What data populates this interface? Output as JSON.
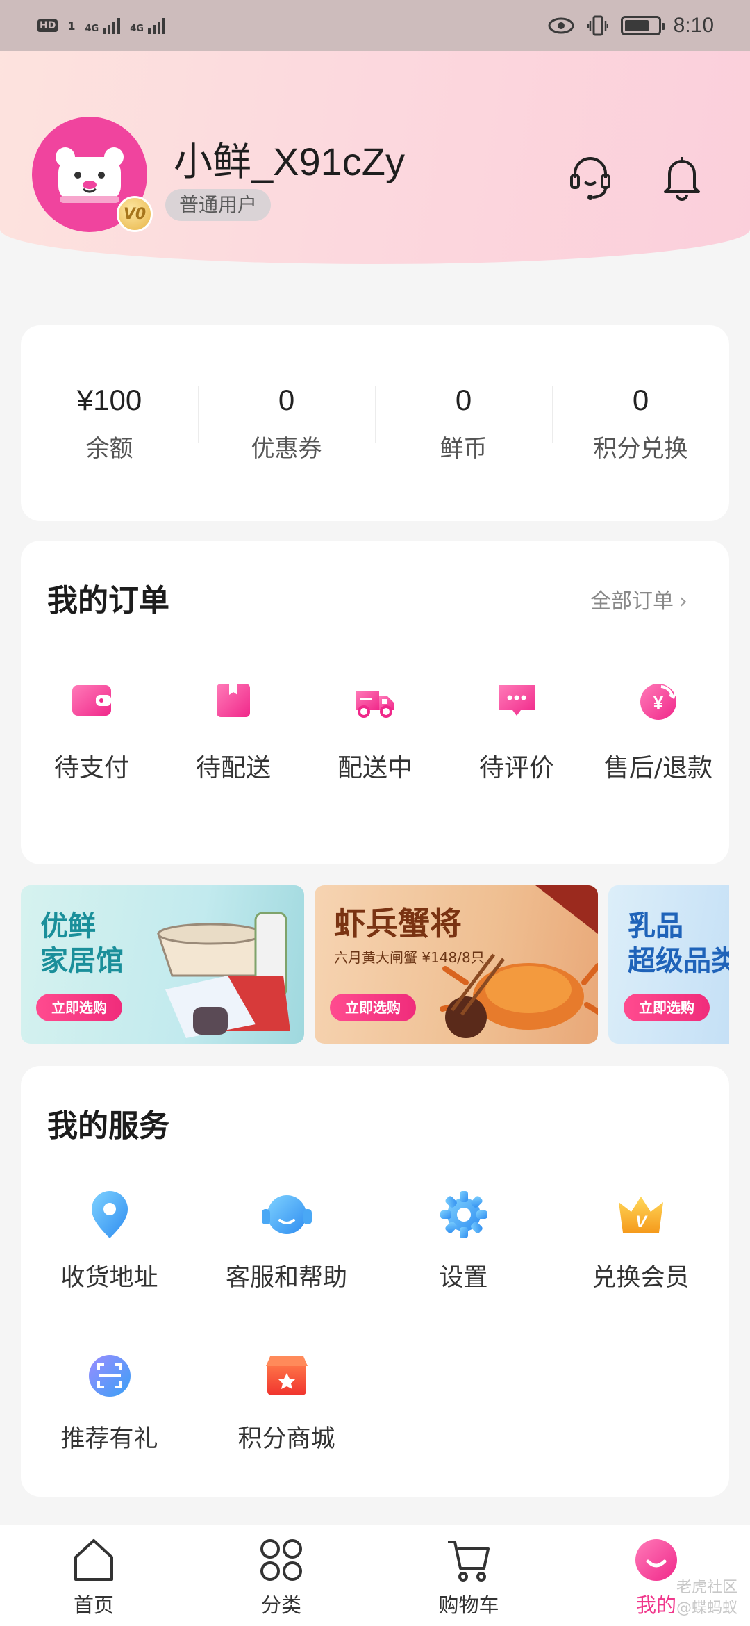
{
  "status_bar": {
    "hd": "HD",
    "sim1": "1",
    "net1": "4G",
    "net2": "4G",
    "time": "8:10",
    "battery_level": 0.75,
    "icons": [
      "eye-icon",
      "vibrate-icon",
      "battery-icon"
    ]
  },
  "profile": {
    "username": "小鲜_X91cZy",
    "level": "普通用户",
    "vip_badge": "V0",
    "avatar_icon": "bear-avatar-icon",
    "header_icons": [
      "headset-icon",
      "bell-icon"
    ]
  },
  "wallet": [
    {
      "value": "¥100",
      "label": "余额"
    },
    {
      "value": "0",
      "label": "优惠券"
    },
    {
      "value": "0",
      "label": "鲜币"
    },
    {
      "value": "0",
      "label": "积分兑换"
    }
  ],
  "orders": {
    "title": "我的订单",
    "all_label": "全部订单",
    "chevron": "›",
    "items": [
      {
        "label": "待支付",
        "icon": "wallet-icon"
      },
      {
        "label": "待配送",
        "icon": "package-icon"
      },
      {
        "label": "配送中",
        "icon": "delivery-truck-icon"
      },
      {
        "label": "待评价",
        "icon": "comment-icon"
      },
      {
        "label": "售后/退款",
        "icon": "refund-icon"
      }
    ]
  },
  "banners": [
    {
      "title_line1": "优鲜",
      "title_line2": "家居馆",
      "subtitle": "",
      "button": "立即选购"
    },
    {
      "title_line1": "虾兵蟹将",
      "title_line2": "",
      "subtitle": "六月黄大闸蟹 ¥148/8只",
      "button": "立即选购"
    },
    {
      "title_line1": "乳品",
      "title_line2": "超级品类",
      "subtitle": "",
      "button": "立即选购"
    }
  ],
  "services": {
    "title": "我的服务",
    "items": [
      {
        "label": "收货地址",
        "icon": "location-pin-icon"
      },
      {
        "label": "客服和帮助",
        "icon": "customer-service-icon"
      },
      {
        "label": "设置",
        "icon": "settings-gear-icon"
      },
      {
        "label": "兑换会员",
        "icon": "crown-icon"
      },
      {
        "label": "推荐有礼",
        "icon": "scan-icon"
      },
      {
        "label": "积分商城",
        "icon": "store-icon"
      }
    ]
  },
  "tabbar": {
    "items": [
      {
        "label": "首页",
        "icon": "home-icon"
      },
      {
        "label": "分类",
        "icon": "grid-icon"
      },
      {
        "label": "购物车",
        "icon": "cart-icon"
      },
      {
        "label": "我的",
        "icon": "profile-smile-icon"
      }
    ],
    "active_index": 3,
    "active_color": "#f0388c"
  },
  "watermark": {
    "line1": "老虎社区",
    "line2": "@蝶蚂蚁"
  },
  "colors": {
    "accent": "#f0388c",
    "header_bg": "#fcd9de"
  }
}
